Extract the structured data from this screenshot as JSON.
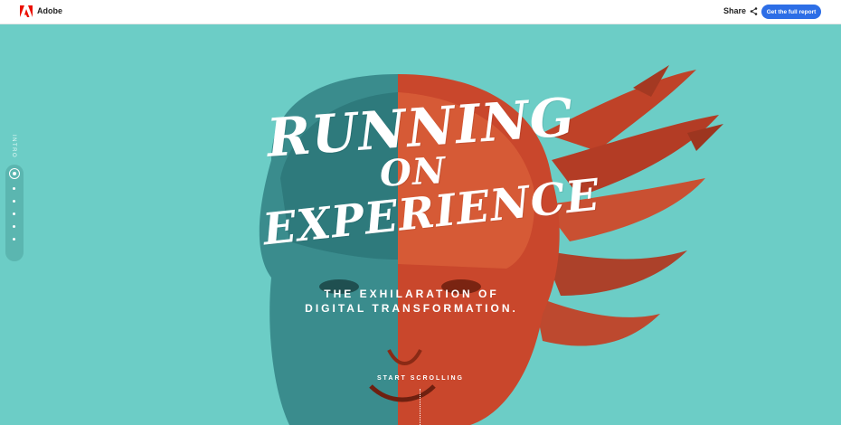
{
  "header": {
    "brand": "Adobe",
    "share_label": "Share",
    "cta_label": "Get the full report"
  },
  "sidenav": {
    "section_label": "INTRO",
    "dots": 6
  },
  "hero": {
    "title_lines": [
      "RUNNING",
      "ON",
      "EXPERIENCE"
    ],
    "subtitle_lines": [
      "THE EXHILARATION OF",
      "DIGITAL TRANSFORMATION."
    ],
    "scroll_label": "START SCROLLING"
  },
  "colors": {
    "background": "#6ccdc6",
    "accent": "#2d6ee6",
    "face_red": "#c9472c",
    "face_teal": "#3b8f90"
  },
  "icons": [
    "adobe-logo-icon",
    "share-icon",
    "nav-dot-icon"
  ]
}
